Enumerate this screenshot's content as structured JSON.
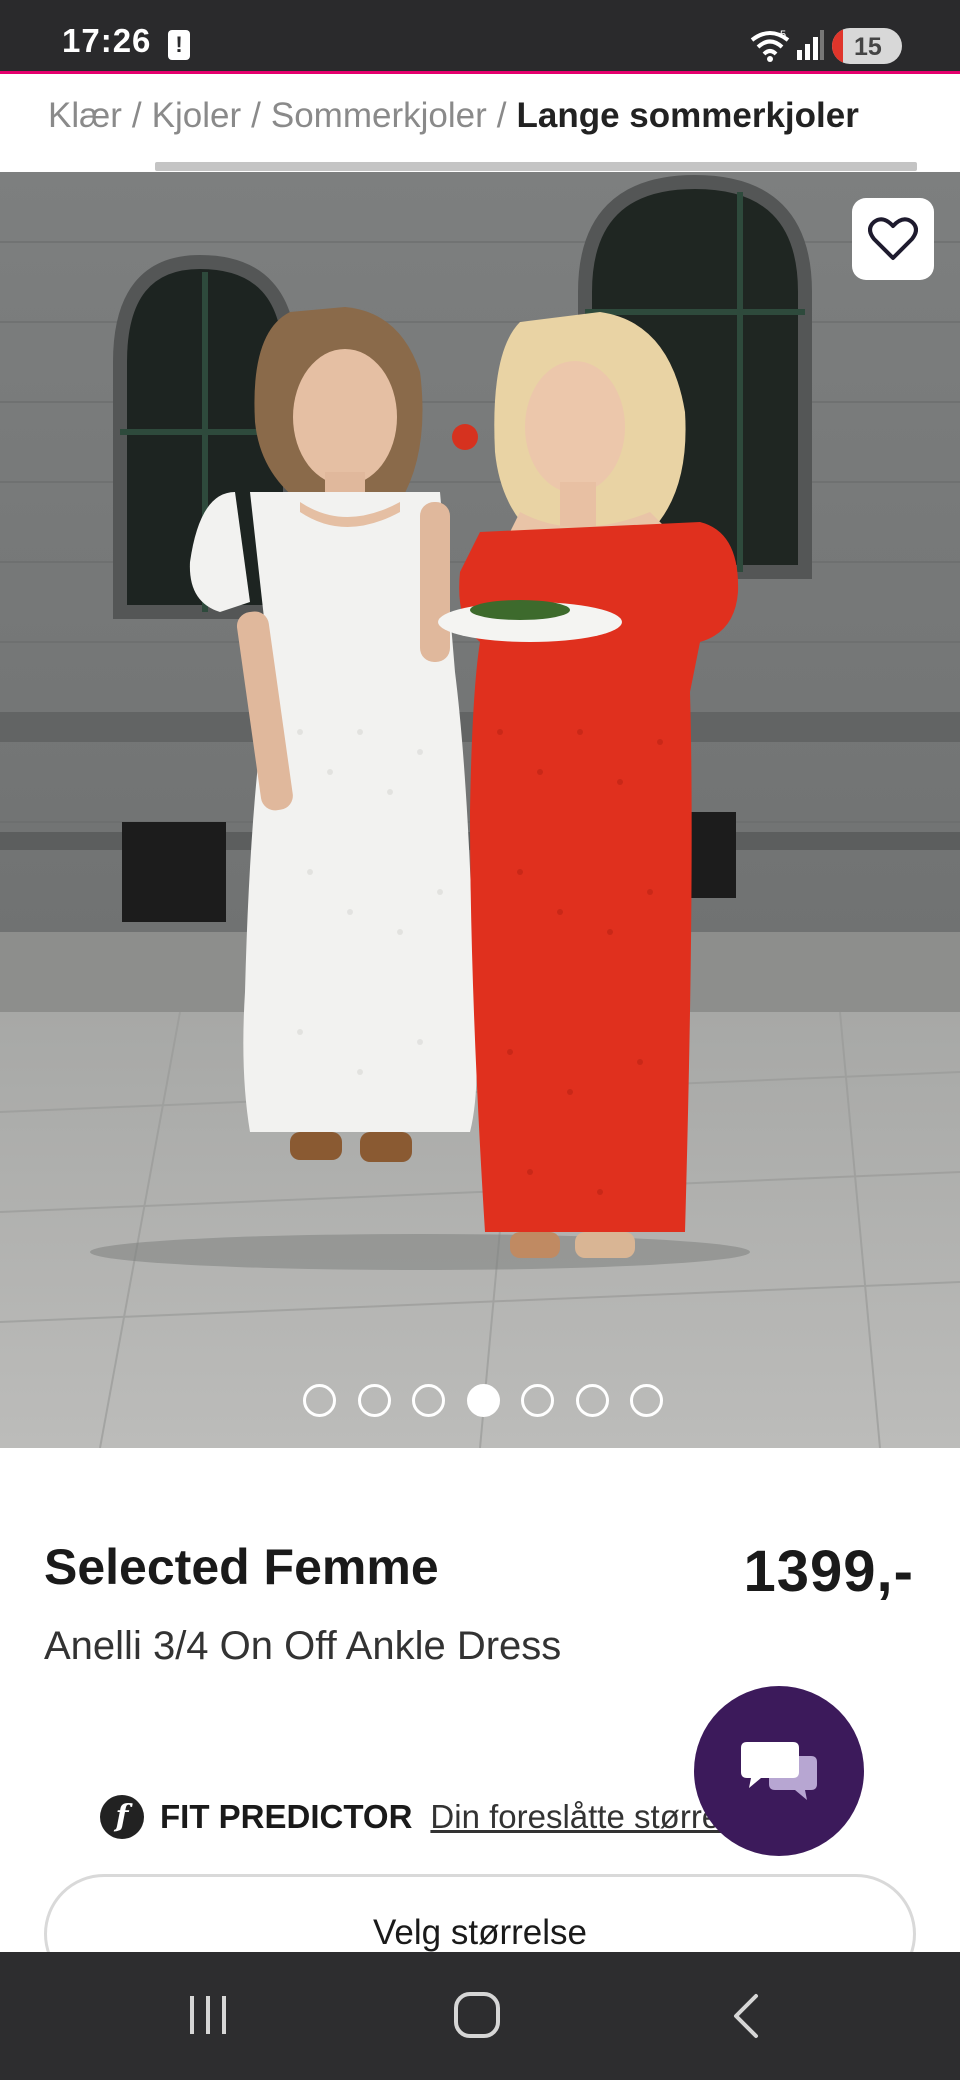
{
  "status_bar": {
    "time": "17:26",
    "alert_icon": "alert-icon",
    "wifi_icon": "wifi-icon",
    "wifi_label": "5",
    "signal_icon": "signal-bars-icon",
    "battery_level": "15",
    "battery_fraction": 0.15
  },
  "breadcrumb": {
    "items": [
      "Klær",
      "Kjoler",
      "Sommerkjoler"
    ],
    "separator": "/",
    "current": "Lange sommerkjoler"
  },
  "gallery": {
    "favorite_icon": "heart-outline-icon",
    "image_count": 7,
    "active_index": 3
  },
  "product": {
    "brand": "Selected Femme",
    "price": "1399,-",
    "name": "Anelli 3/4 On Off Ankle Dress"
  },
  "fit_predictor": {
    "logo_letter": "f",
    "title": "FIT PREDICTOR",
    "link": "Din foreslåtte størrelse"
  },
  "chat": {
    "icon": "chat-bubbles-icon"
  },
  "size_select": {
    "label": "Velg størrelse"
  },
  "nav_bar": {
    "recent_icon": "recent-apps-icon",
    "home_icon": "home-icon",
    "back_icon": "back-icon"
  },
  "colors": {
    "accent": "#e5006d",
    "chat_bg": "#3c1a5b",
    "status_bar_bg": "#2a2a2c",
    "dress_red": "#e0301e",
    "dress_white": "#f2f2f0"
  }
}
